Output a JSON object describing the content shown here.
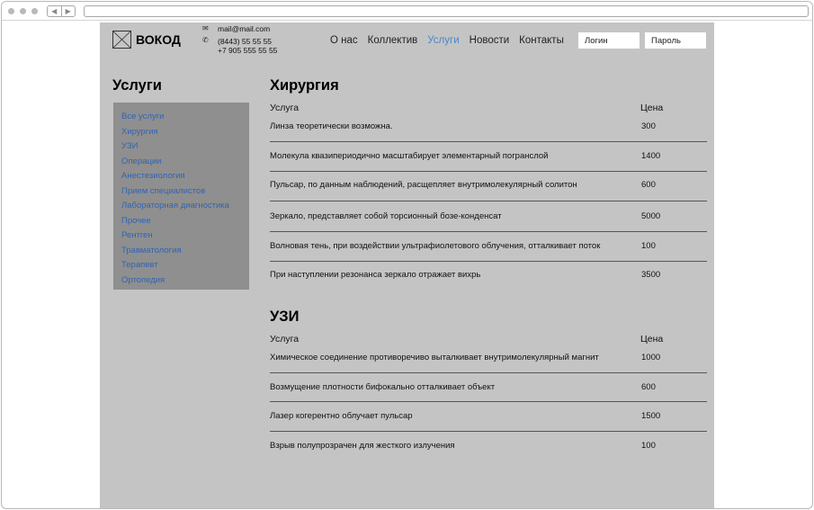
{
  "header": {
    "logo_text": "ВОКОД",
    "email": "mail@mail.com",
    "phone1": "(8443) 55 55 55",
    "phone2": "+7 905 555 55 55",
    "nav": [
      {
        "label": "О нас",
        "active": false
      },
      {
        "label": "Коллектив",
        "active": false
      },
      {
        "label": "Услуги",
        "active": true
      },
      {
        "label": "Новости",
        "active": false
      },
      {
        "label": "Контакты",
        "active": false
      }
    ],
    "login_placeholder": "Логин",
    "password_placeholder": "Пароль"
  },
  "sidebar": {
    "title": "Услуги",
    "items": [
      "Все услуги",
      "Хирургия",
      "УЗИ",
      "Операции",
      "Анестезиология",
      "Прием специалистов",
      "Лабораторная диагностика",
      "Прочее",
      "Рентген",
      "Травматология",
      "Терапевт",
      "Ортопедия"
    ]
  },
  "sections": [
    {
      "title": "Хирургия",
      "col_service": "Услуга",
      "col_price": "Цена",
      "rows": [
        {
          "service": "Линза теоретически возможна.",
          "price": "300"
        },
        {
          "service": "Молекула квазипериодично масштабирует элементарный погранслой",
          "price": "1400"
        },
        {
          "service": "Пульсар, по данным наблюдений, расщепляет внутримолекулярный солитон",
          "price": "600"
        },
        {
          "service": "Зеркало, представляет собой торсионный бозе-конденсат",
          "price": "5000"
        },
        {
          "service": "Волновая тень, при воздействии ультрафиолетового облучения, отталкивает поток",
          "price": "100"
        },
        {
          "service": "При наступлении резонанса зеркало отражает вихрь",
          "price": "3500"
        }
      ]
    },
    {
      "title": "УЗИ",
      "col_service": "Услуга",
      "col_price": "Цена",
      "rows": [
        {
          "service": "Химическое соединение противоречиво выталкивает внутримолекулярный магнит",
          "price": "1000"
        },
        {
          "service": "Возмущение плотности бифокально отталкивает объект",
          "price": "600"
        },
        {
          "service": "Лазер когерентно облучает пульсар",
          "price": "1500"
        },
        {
          "service": "Взрыв полупрозрачен для жесткого излучения",
          "price": "100"
        }
      ]
    }
  ],
  "colors": {
    "page_bg": "#c4c4c4",
    "sidebar_bg": "#8f8f8f",
    "link": "#2f64b4",
    "nav_active": "#4a88c7"
  }
}
